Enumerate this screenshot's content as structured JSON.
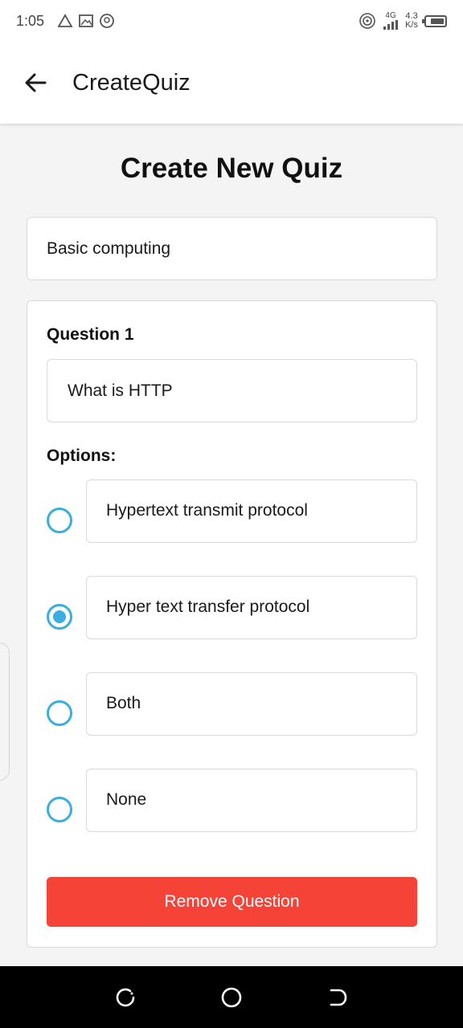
{
  "status_bar": {
    "time": "1:05",
    "network_type": "4G",
    "net_speed_value": "4.3",
    "net_speed_unit": "K/s",
    "icons": [
      "warning-triangle-icon",
      "image-icon",
      "location-icon",
      "hotspot-icon",
      "signal-icon",
      "battery-icon"
    ]
  },
  "app_bar": {
    "title": "CreateQuiz",
    "back_icon": "arrow-left-icon"
  },
  "page": {
    "title": "Create New Quiz"
  },
  "quiz": {
    "title_value": "Basic computing"
  },
  "question": {
    "label": "Question 1",
    "text_value": "What is HTTP",
    "options_label": "Options:",
    "options": [
      {
        "text": "Hypertext transmit protocol",
        "selected": false
      },
      {
        "text": "Hyper text transfer protocol",
        "selected": true
      },
      {
        "text": "Both",
        "selected": false
      },
      {
        "text": "None",
        "selected": false
      }
    ],
    "remove_label": "Remove Question"
  },
  "colors": {
    "accent": "#3aaee0",
    "danger": "#f54337",
    "background": "#f4f4f4"
  },
  "nav_bar": {
    "icons": [
      "recent-apps-icon",
      "home-icon",
      "back-nav-icon"
    ]
  }
}
